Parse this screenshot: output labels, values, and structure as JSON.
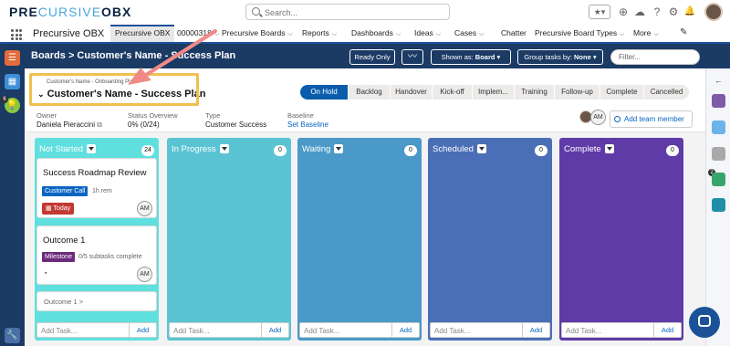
{
  "brand": {
    "logo_dark_1": "PRE",
    "logo_light": "CURSIVE",
    "logo_dark_2": "OBX"
  },
  "search": {
    "placeholder": "Search..."
  },
  "utility": {
    "fav": "★▾",
    "add": "⊕",
    "help": "?",
    "settings": "⚙",
    "bell": "🔔"
  },
  "nav": {
    "app_name": "Precursive OBX",
    "items": [
      {
        "label": "Precursive OBX"
      },
      {
        "label": "00000318"
      },
      {
        "label": "Precursive Boards"
      },
      {
        "label": "Reports"
      },
      {
        "label": "Dashboards"
      },
      {
        "label": "Ideas"
      },
      {
        "label": "Cases"
      },
      {
        "label": "Chatter"
      },
      {
        "label": "Precursive Board Types"
      },
      {
        "label": "More"
      }
    ],
    "chev": "⌵"
  },
  "board_header": {
    "title": "Boards > Customer's Name - Success Plan",
    "ready_only": "Ready Only",
    "shown_as_prefix": "Shown as: ",
    "shown_as_value": "Board",
    "group_prefix": "Group tasks by: ",
    "group_value": "None",
    "filter_placeholder": "Filter..."
  },
  "plan": {
    "breadcrumb": "Customer's Name - Onboarding Plan",
    "title": "Customer's Name - Success Plan",
    "stages": [
      "On Hold",
      "Backlog",
      "Handover",
      "Kick-off",
      "Implem...",
      "Training",
      "Follow-up",
      "Complete",
      "Cancelled"
    ],
    "active_stage": "On Hold",
    "meta": {
      "owner_label": "Owner",
      "owner_value": "Daniela Pieraccini",
      "status_label": "Status Overview",
      "status_value": "0% (0/24)",
      "type_label": "Type",
      "type_value": "Customer Success",
      "baseline_label": "Baseline",
      "baseline_value": "Set Baseline"
    },
    "member_initials": "AM",
    "add_member": "Add team member"
  },
  "columns": [
    {
      "title": "Not Started",
      "count": "24",
      "color": "#5fe0df"
    },
    {
      "title": "In Progress",
      "count": "0",
      "color": "#5ac4d4"
    },
    {
      "title": "Waiting",
      "count": "0",
      "color": "#4a99c9"
    },
    {
      "title": "Scheduled",
      "count": "0",
      "color": "#4b6fb7"
    },
    {
      "title": "Complete",
      "count": "0",
      "color": "#5f3ba7"
    }
  ],
  "cards": {
    "c1": {
      "title": "Success Roadmap Review",
      "tag": "Customer Call",
      "tag_color": "#0b65c2",
      "sub": "1h rem",
      "today": "Today",
      "avatar": "AM"
    },
    "c2": {
      "title": "Outcome 1",
      "tag": "Milestone",
      "tag_color": "#6b2a7b",
      "sub": "0/5 subtasks complete",
      "avatar": "AM"
    },
    "c3": {
      "title": "Outcome 1 >"
    }
  },
  "add_task": {
    "placeholder": "Add Task...",
    "button": "Add"
  },
  "rail_badges": {
    "left": "6",
    "right": "2"
  }
}
